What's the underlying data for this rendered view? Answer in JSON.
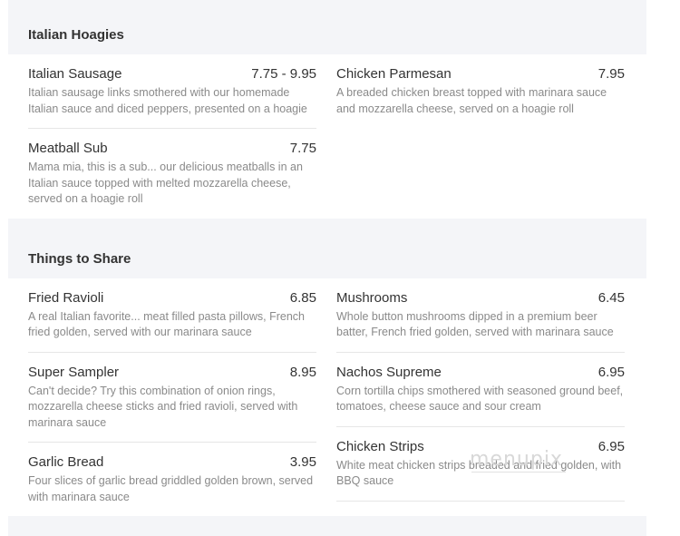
{
  "sections": [
    {
      "title": "Italian Hoagies",
      "left": [
        {
          "name": "Italian Sausage",
          "price": "7.75 - 9.95",
          "desc": "Italian sausage links smothered with our homemade Italian sauce and diced peppers, presented on a hoagie"
        },
        {
          "name": "Meatball Sub",
          "price": "7.75",
          "desc": "Mama mia, this is a sub... our delicious meatballs in an Italian sauce topped with melted mozzarella cheese, served on a hoagie roll"
        }
      ],
      "right": [
        {
          "name": "Chicken Parmesan",
          "price": "7.95",
          "desc": "A breaded chicken breast topped with marinara sauce and mozzarella cheese, served on a hoagie roll"
        }
      ]
    },
    {
      "title": "Things to Share",
      "left": [
        {
          "name": "Fried Ravioli",
          "price": "6.85",
          "desc": "A real Italian favorite... meat filled pasta pillows, French fried golden, served with our marinara sauce"
        },
        {
          "name": "Super Sampler",
          "price": "8.95",
          "desc": "Can't decide? Try this combination of onion rings, mozzarella cheese sticks and fried ravioli, served with marinara sauce"
        },
        {
          "name": "Garlic Bread",
          "price": "3.95",
          "desc": "Four slices of garlic bread griddled golden brown, served with marinara sauce"
        }
      ],
      "right": [
        {
          "name": "Mushrooms",
          "price": "6.45",
          "desc": "Whole button mushrooms dipped in a premium beer batter, French fried golden, served with marinara sauce"
        },
        {
          "name": "Nachos Supreme",
          "price": "6.95",
          "desc": "Corn tortilla chips smothered with seasoned ground beef, tomatoes, cheese sauce and sour cream"
        },
        {
          "name": "Chicken Strips",
          "price": "6.95",
          "desc": "White meat chicken strips breaded and fried golden, with BBQ sauce"
        }
      ]
    }
  ],
  "watermark": "menupix"
}
